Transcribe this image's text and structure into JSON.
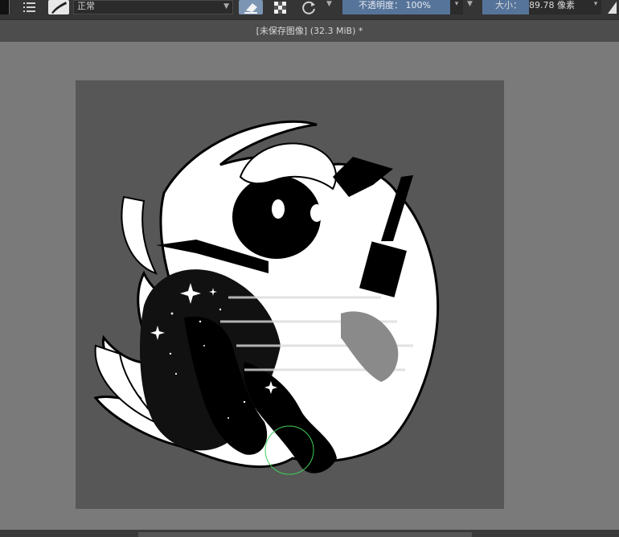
{
  "toolbar": {
    "blend_mode": "正常",
    "opacity_label": "不透明度：",
    "opacity_value": "100%",
    "size_label": "大小：",
    "size_value": "89.78 像素"
  },
  "document": {
    "title": "[未保存图像]  (32.3 MiB) *"
  },
  "colors": {
    "toolbar_bg": "#353535",
    "accent": "#56749a",
    "canvas_bg": "#575757",
    "workspace_bg": "#7a7a7a",
    "brush_cursor": "#3ecf5a"
  },
  "icons": [
    "foreground-color-swatch",
    "list-icon",
    "brush-preset-icon",
    "eraser-icon",
    "alpha-lock-icon",
    "reload-icon",
    "triangle-icon"
  ]
}
